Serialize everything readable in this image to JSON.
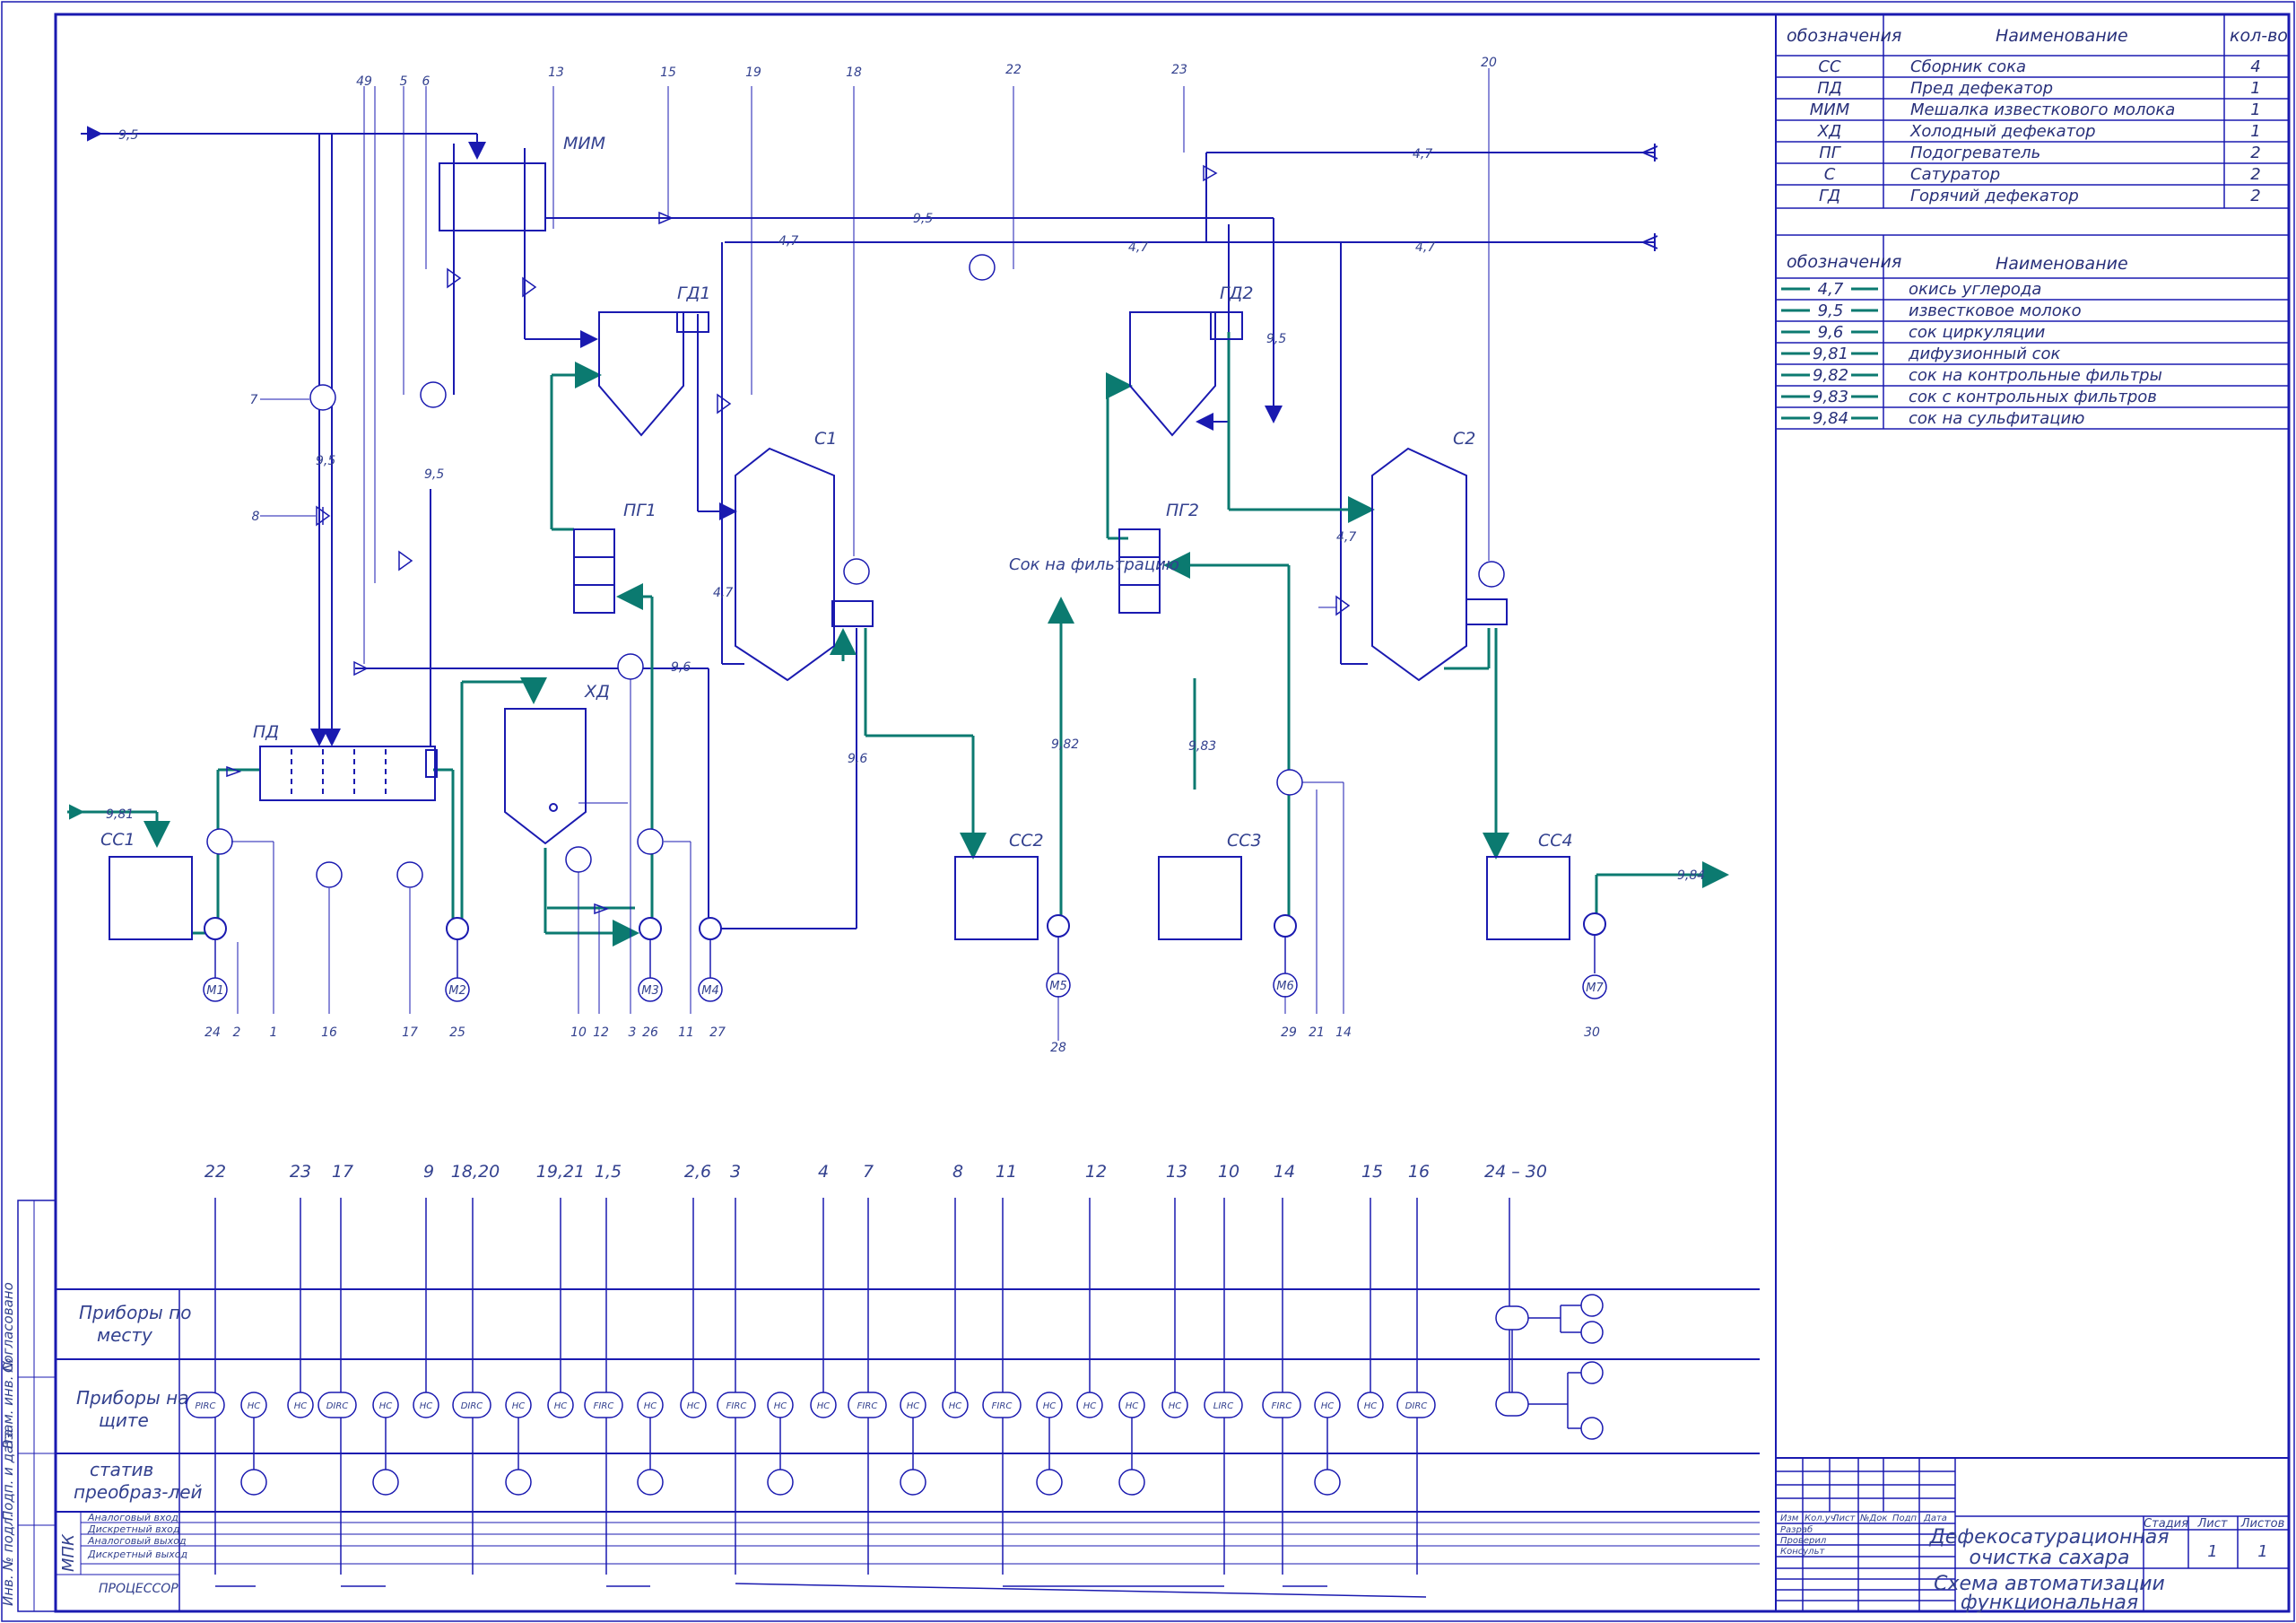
{
  "colors": {
    "frame": "#1a1ab0",
    "process": "#0b7a70",
    "ink": "#33418f"
  },
  "spec_table": {
    "headers": [
      "обозначения",
      "Наименование",
      "кол-во"
    ],
    "rows": [
      {
        "code": "СС",
        "name": "Сборник сока",
        "qty": "4"
      },
      {
        "code": "ПД",
        "name": "Пред дефекатор",
        "qty": "1"
      },
      {
        "code": "МИМ",
        "name": "Мешалка известкового молока",
        "qty": "1"
      },
      {
        "code": "ХД",
        "name": "Холодный дефекатор",
        "qty": "1"
      },
      {
        "code": "ПГ",
        "name": "Подогреватель",
        "qty": "2"
      },
      {
        "code": "С",
        "name": "Сатуратор",
        "qty": "2"
      },
      {
        "code": "ГД",
        "name": "Горячий дефекатор",
        "qty": "2"
      }
    ]
  },
  "legend_table": {
    "headers": [
      "обозначения",
      "Наименование"
    ],
    "rows": [
      {
        "code": "4,7",
        "name": "окись углерода"
      },
      {
        "code": "9,5",
        "name": "известковое молоко"
      },
      {
        "code": "9,6",
        "name": "сок циркуляции"
      },
      {
        "code": "9,81",
        "name": "дифузионный сок"
      },
      {
        "code": "9,82",
        "name": "сок на контрольные фильтры"
      },
      {
        "code": "9,83",
        "name": "сок с контрольных фильтров"
      },
      {
        "code": "9,84",
        "name": "сок на сульфитацию"
      }
    ]
  },
  "equipment": {
    "mim": "МИМ",
    "gd1": "ГД1",
    "gd2": "ГД2",
    "pg1": "ПГ1",
    "pg2": "ПГ2",
    "s1": "С1",
    "s2": "С2",
    "pd": "ПД",
    "hd": "ХД",
    "cc1": "СС1",
    "cc2": "СС2",
    "cc3": "СС3",
    "cc4": "СС4"
  },
  "flow_labels": {
    "f95_in": "9,5",
    "f95_mid": "9,5",
    "f95_left": "9,5",
    "f95_pd": "9,5",
    "f95_right": "9,5",
    "f47_top": "4,7",
    "f47_mid": "4,7",
    "f47_right": "4,7",
    "f47_s1": "4,7",
    "f47_s2": "4,7",
    "f47_gd1": "4,7",
    "f96_a": "9,6",
    "f96_b": "9,6",
    "f981": "9,81",
    "f982": "9,82",
    "f983": "9,83",
    "f984": "9,84",
    "juice_note": "Сок на фильтрацию"
  },
  "tap_numbers": [
    "49",
    "5",
    "6",
    "13",
    "15",
    "19",
    "18",
    "22",
    "23",
    "20",
    "7",
    "8"
  ],
  "bottom_numbers": [
    "24",
    "2",
    "1",
    "16",
    "17",
    "25",
    "10",
    "12",
    "3",
    "26",
    "11",
    "27",
    "28",
    "29",
    "21",
    "14",
    "30"
  ],
  "motors": [
    "М1",
    "М2",
    "М3",
    "М4",
    "М5",
    "М6",
    "М7"
  ],
  "column_numbers": [
    "22",
    "23",
    "17",
    "9",
    "18,20",
    "19,21",
    "1,5",
    "2,6",
    "3",
    "4",
    "7",
    "8",
    "11",
    "12",
    "13",
    "10",
    "14",
    "15",
    "16",
    "24 – 30"
  ],
  "row_labels": {
    "local_1": "Приборы по",
    "local_2": "месту",
    "panel_1": "Приборы на",
    "panel_2": "щите",
    "stand_1": "статив",
    "stand_2": "преобраз-лей",
    "mpk": "МПК",
    "analog_in": "Аналоговый вход",
    "discrete_in": "Дискретный вход",
    "analog_out": "Аналоговый выход",
    "discrete_out": "Дискретный выход",
    "processor": "ПРОЦЕССОР"
  },
  "panel_tags": [
    "PIRC",
    "HC",
    "HC",
    "DIRC",
    "HC",
    "HC",
    "DIRC",
    "HC",
    "HC",
    "FIRC",
    "HC",
    "HC",
    "FIRC",
    "HC",
    "HC",
    "FIRC",
    "HC",
    "HC",
    "FIRC",
    "HC",
    "HC",
    "HC",
    "HC",
    "LIRC",
    "FIRC",
    "HC",
    "HC",
    "DIRC"
  ],
  "title_block": {
    "title_1": "Дефекосатурационная",
    "title_2": "очистка сахара",
    "subtitle_1": "Схема автоматизации",
    "subtitle_2": "функциональная",
    "stage": "Стадия",
    "sheet": "Лист",
    "sheets": "Листов",
    "sheet_no": "1",
    "sheets_no": "1",
    "rows": [
      "Изм",
      "Кол.уч",
      "Лист",
      "№Док",
      "Подп",
      "Дата"
    ],
    "roles": [
      "Разраб",
      "Проверил",
      "Консульт"
    ]
  },
  "side_stamp": [
    "Согласовано",
    "Взам. инв. №",
    "Подп. и дата",
    "Инв. № подл."
  ]
}
